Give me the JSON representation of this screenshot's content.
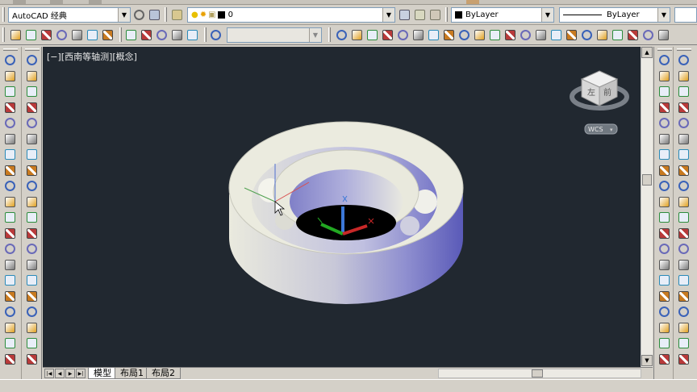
{
  "toolbar1": {
    "workspace": "AutoCAD 经典",
    "layer": "0",
    "color": "ByLayer",
    "linetype": "ByLayer"
  },
  "viewport": {
    "label": "[−][西南等轴测][概念]",
    "background": "#212830",
    "viewcube": {
      "face_left": "左",
      "face_front": "前",
      "coordinate_system": "WCS"
    },
    "model_colors": {
      "light": "#e8e8dc",
      "accent": "#6464c8"
    }
  },
  "layout_tabs": [
    "模型",
    "布局1",
    "布局2"
  ],
  "icons": {
    "left_toolbar": [
      "line-icon",
      "construction-line-icon",
      "polyline-icon",
      "polygon-icon",
      "rectangle-icon",
      "arc-icon",
      "circle-icon",
      "revision-cloud-icon",
      "spline-icon",
      "ellipse-icon",
      "ellipse-arc-icon",
      "insert-block-icon",
      "make-block-icon",
      "point-icon",
      "hatch-icon",
      "gradient-icon",
      "region-icon",
      "table-icon",
      "multiline-text-icon",
      "add-selected-icon"
    ],
    "left_toolbar2": [
      "box-icon",
      "wedge-icon",
      "cone-icon",
      "sphere-icon",
      "cylinder-icon",
      "torus-icon",
      "pyramid-icon",
      "planar-surface-icon",
      "extrude-icon",
      "presspull-icon",
      "sweep-icon",
      "revolve-icon",
      "loft-icon",
      "union-icon",
      "subtract-icon",
      "intersect-icon",
      "3d-move-icon",
      "3d-rotate-icon",
      "3d-align-icon",
      "3d-array-icon"
    ],
    "right_toolbar": [
      "linear-dimension-icon",
      "aligned-dimension-icon",
      "arc-length-icon",
      "ordinate-dimension-icon",
      "radius-dimension-icon",
      "jogged-dimension-icon",
      "diameter-dimension-icon",
      "angular-dimension-icon",
      "quick-dimension-icon",
      "baseline-dimension-icon",
      "continue-dimension-icon",
      "dimension-space-icon",
      "dimension-break-icon",
      "tolerance-icon",
      "center-mark-icon",
      "inspection-icon",
      "jogged-linear-icon",
      "dimension-edit-icon",
      "dimension-text-edit-icon",
      "dimension-update-icon"
    ],
    "right_toolbar2": [
      "erase-icon",
      "copy-icon",
      "mirror-icon",
      "offset-icon",
      "array-icon",
      "move-icon",
      "rotate-icon",
      "scale-icon",
      "stretch-icon",
      "trim-icon",
      "extend-icon",
      "break-at-point-icon",
      "break-icon",
      "join-icon",
      "chamfer-icon",
      "fillet-icon",
      "explode-icon",
      "draw-order-icon",
      "bring-to-front-icon",
      "send-to-back-icon"
    ]
  }
}
